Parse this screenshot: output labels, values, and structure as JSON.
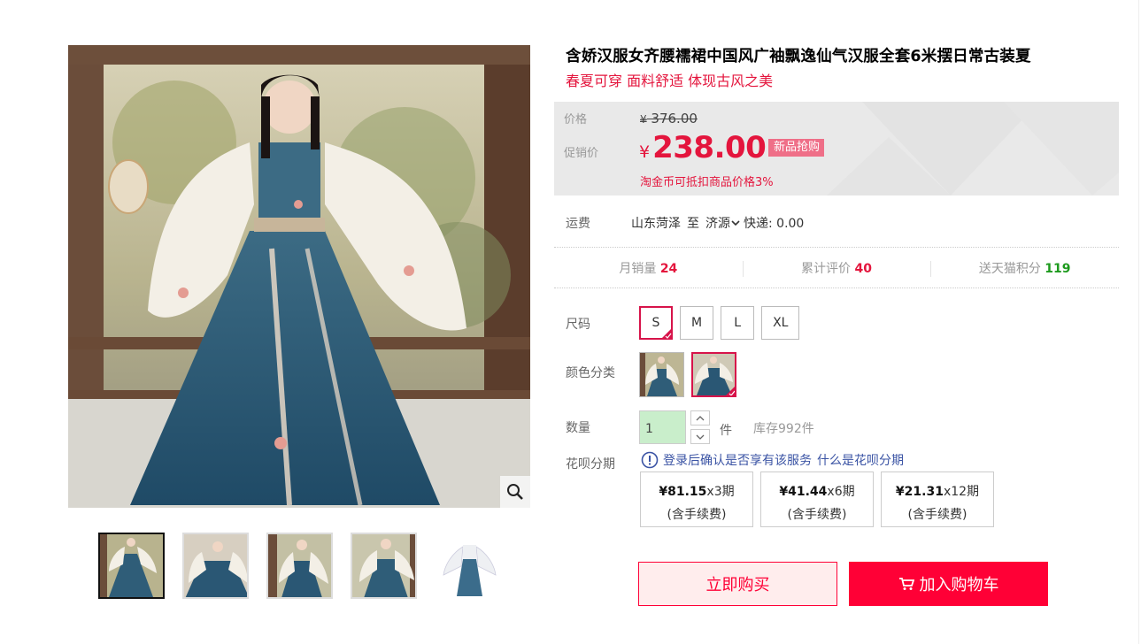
{
  "product": {
    "title": "含娇汉服女齐腰襦裙中国风广袖飘逸仙气汉服全套6米摆日常古装夏",
    "subtitle": "春夏可穿 面料舒适 体现古风之美"
  },
  "gallery": {
    "zoom_icon": "magnifier-icon",
    "thumb_count": 5,
    "active_thumb": 1
  },
  "price": {
    "orig_label": "价格",
    "orig_currency": "¥",
    "orig_value": "376.00",
    "promo_label": "促销价",
    "promo_currency": "¥",
    "promo_value": "238.00",
    "promo_tag": "新品抢购",
    "coin_note": "淘金币可抵扣商品价格3%"
  },
  "shipping": {
    "label": "运费",
    "from": "山东菏泽",
    "to_word": "至",
    "to": "济源",
    "fee": "快递: 0.00"
  },
  "stats": {
    "monthly_label": "月销量",
    "monthly_value": "24",
    "reviews_label": "累计评价",
    "reviews_value": "40",
    "points_label": "送天猫积分",
    "points_value": "119"
  },
  "size": {
    "label": "尺码",
    "options": [
      "S",
      "M",
      "L",
      "XL"
    ],
    "selected": "S"
  },
  "color": {
    "label": "颜色分类",
    "selected_index": 1
  },
  "quantity": {
    "label": "数量",
    "value": "1",
    "unit": "件",
    "stock": "库存992件"
  },
  "huabei": {
    "label": "花呗分期",
    "note": "登录后确认是否享有该服务",
    "link": "什么是花呗分期",
    "plans": [
      {
        "amount": "¥81.15",
        "term": "x3期",
        "fee": "(含手续费)"
      },
      {
        "amount": "¥41.44",
        "term": "x6期",
        "fee": "(含手续费)"
      },
      {
        "amount": "¥21.31",
        "term": "x12期",
        "fee": "(含手续费)"
      }
    ]
  },
  "actions": {
    "buy_now": "立即购买",
    "add_cart": "加入购物车"
  },
  "colors": {
    "accent": "#ff0036",
    "price_red": "#e4153d",
    "selected_border": "#d7134a",
    "points_green": "#1d9a1d",
    "link_blue": "#3a53a4"
  }
}
